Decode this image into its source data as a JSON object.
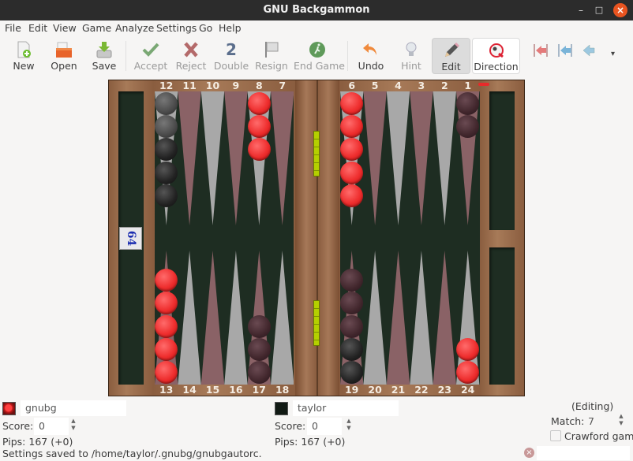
{
  "window": {
    "title": "GNU Backgammon",
    "controls": {
      "minimize": "–",
      "maximize": "□",
      "close": "×"
    }
  },
  "menu": [
    "File",
    "Edit",
    "View",
    "Game",
    "Analyze",
    "Settings",
    "Go",
    "Help"
  ],
  "toolbar": {
    "buttons": [
      {
        "label": "New",
        "icon": "new-file-icon",
        "enabled": true
      },
      {
        "label": "Open",
        "icon": "open-folder-icon",
        "enabled": true
      },
      {
        "label": "Save",
        "icon": "save-disk-icon",
        "enabled": true
      },
      {
        "label": "Accept",
        "icon": "checkmark-icon",
        "enabled": false
      },
      {
        "label": "Reject",
        "icon": "x-mark-icon",
        "enabled": false
      },
      {
        "label": "Double",
        "icon": "double-2-icon",
        "enabled": false
      },
      {
        "label": "Resign",
        "icon": "white-flag-icon",
        "enabled": false
      },
      {
        "label": "End Game",
        "icon": "running-man-icon",
        "enabled": false
      },
      {
        "label": "Undo",
        "icon": "undo-arrow-icon",
        "enabled": true
      },
      {
        "label": "Hint",
        "icon": "lightbulb-icon",
        "enabled": false
      },
      {
        "label": "Edit",
        "icon": "pencil-icon",
        "enabled": true,
        "active": true
      },
      {
        "label": "Direction",
        "icon": "direction-icon",
        "enabled": true
      }
    ],
    "nav_icons": [
      "previous-game-icon",
      "previous-roll-icon",
      "previous-move-icon"
    ],
    "overflow": "▾",
    "double_glyph": "2"
  },
  "board": {
    "top_points": [
      "12",
      "11",
      "10",
      "9",
      "8",
      "7",
      "6",
      "5",
      "4",
      "3",
      "2",
      "1"
    ],
    "bottom_points": [
      "13",
      "14",
      "15",
      "16",
      "17",
      "18",
      "19",
      "20",
      "21",
      "22",
      "23",
      "24"
    ],
    "cube_value": "64",
    "checkers": [
      {
        "point": 12,
        "count": 5,
        "color": "dark"
      },
      {
        "point": 8,
        "count": 3,
        "color": "red"
      },
      {
        "point": 6,
        "count": 5,
        "color": "red"
      },
      {
        "point": 1,
        "count": 2,
        "color": "dark"
      },
      {
        "point": 13,
        "count": 5,
        "color": "red"
      },
      {
        "point": 17,
        "count": 3,
        "color": "dark"
      },
      {
        "point": 19,
        "count": 5,
        "color": "dark"
      },
      {
        "point": 24,
        "count": 2,
        "color": "red"
      }
    ],
    "colors": {
      "red": "#ee2d2d",
      "dark": "#41262c",
      "felt": "#1e2d22",
      "wood": "#8a5d3f",
      "point_light": "#a8a8a8",
      "point_dark": "#8a6266"
    }
  },
  "players": [
    {
      "name": "gnubg",
      "color": "#e82626",
      "score_label": "Score:",
      "score": "0",
      "pips": "Pips: 167 (+0)"
    },
    {
      "name": "taylor",
      "color": "#111a14",
      "score_label": "Score:",
      "score": "0",
      "pips": "Pips: 167 (+0)"
    }
  ],
  "match": {
    "status": "(Editing)",
    "label": "Match:",
    "value": "7",
    "crawford_label": "Crawford game",
    "crawford_checked": false
  },
  "statusbar": {
    "message": "Settings saved to /home/taylor/.gnubg/gnubgautorc."
  }
}
